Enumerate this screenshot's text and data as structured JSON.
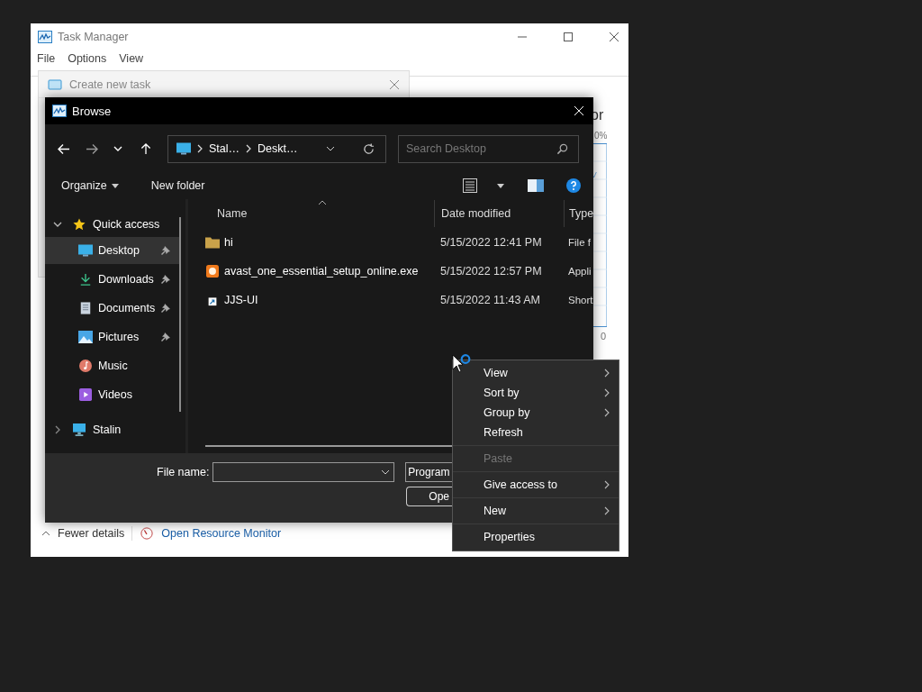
{
  "task_manager": {
    "title": "Task Manager",
    "menu": [
      "File",
      "Options",
      "View"
    ],
    "panel_heading": "or",
    "graph_top_label": "0%",
    "graph_bottom_label": "0",
    "fewer_details": "Fewer details",
    "resource_monitor_link": "Open Resource Monitor"
  },
  "create_task_dialog": {
    "title": "Create new task"
  },
  "browse": {
    "title": "Browse",
    "breadcrumb": [
      "Stal…",
      "Deskt…"
    ],
    "search": {
      "placeholder": "Search Desktop"
    },
    "toolbar": [
      "Organize",
      "New folder"
    ],
    "columns": [
      "Name",
      "Date modified",
      "Type"
    ],
    "nav": [
      {
        "label": "Quick access",
        "kind": "star",
        "expanded": true,
        "children": [
          {
            "label": "Desktop",
            "kind": "desktop",
            "selected": true,
            "pinned": true
          },
          {
            "label": "Downloads",
            "kind": "download",
            "selected": false,
            "pinned": true
          },
          {
            "label": "Documents",
            "kind": "documents",
            "selected": false,
            "pinned": true
          },
          {
            "label": "Pictures",
            "kind": "pictures",
            "selected": false,
            "pinned": true
          },
          {
            "label": "Music",
            "kind": "music",
            "selected": false,
            "pinned": false
          },
          {
            "label": "Videos",
            "kind": "videos",
            "selected": false,
            "pinned": false
          }
        ]
      },
      {
        "label": "Stalin",
        "kind": "pc",
        "expanded": false
      }
    ],
    "files": [
      {
        "kind": "folder",
        "name": "hi",
        "date": "5/15/2022 12:41 PM",
        "type": "File f"
      },
      {
        "kind": "app",
        "name": "avast_one_essential_setup_online.exe",
        "date": "5/15/2022 12:57 PM",
        "type": "Appli"
      },
      {
        "kind": "shortcut",
        "name": "JJS-UI",
        "date": "5/15/2022 11:43 AM",
        "type": "Short"
      }
    ],
    "file_name_label": "File name:",
    "file_type_filter": "Program",
    "open_button": "Ope"
  },
  "context_menu": [
    {
      "label": "View",
      "submenu": true,
      "disabled": false,
      "divider_before": false
    },
    {
      "label": "Sort by",
      "submenu": true,
      "disabled": false,
      "divider_before": false
    },
    {
      "label": "Group by",
      "submenu": true,
      "disabled": false,
      "divider_before": false
    },
    {
      "label": "Refresh",
      "submenu": false,
      "disabled": false,
      "divider_before": false
    },
    {
      "label": "Paste",
      "submenu": false,
      "disabled": true,
      "divider_before": true
    },
    {
      "label": "Give access to",
      "submenu": true,
      "disabled": false,
      "divider_before": true
    },
    {
      "label": "New",
      "submenu": true,
      "disabled": false,
      "divider_before": true
    },
    {
      "label": "Properties",
      "submenu": false,
      "disabled": false,
      "divider_before": true
    }
  ]
}
